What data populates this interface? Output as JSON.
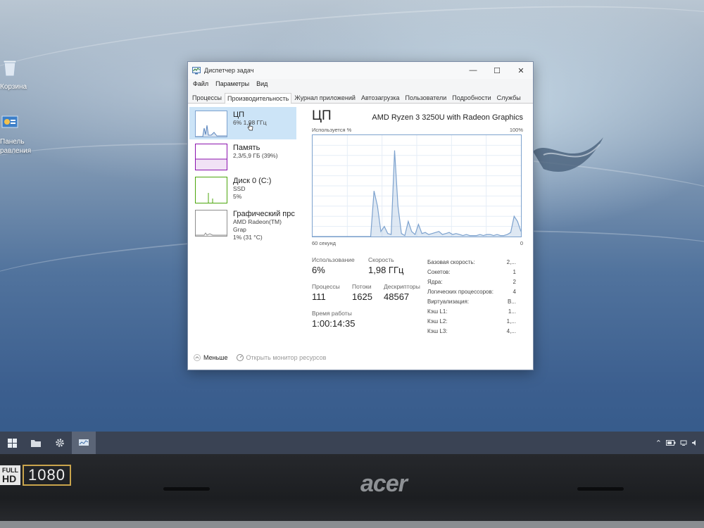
{
  "desktop": {
    "icons": [
      {
        "label": "Корзина"
      },
      {
        "label_line1": "Панель",
        "label_line2": "равления"
      }
    ]
  },
  "window": {
    "title": "Диспетчер задач",
    "menu": [
      "Файл",
      "Параметры",
      "Вид"
    ],
    "tabs": [
      "Процессы",
      "Производительность",
      "Журнал приложений",
      "Автозагрузка",
      "Пользователи",
      "Подробности",
      "Службы"
    ],
    "active_tab": 1
  },
  "sidebar": {
    "items": [
      {
        "name": "ЦП",
        "sub1": "6% 1,98 ГГц",
        "sub2": ""
      },
      {
        "name": "Память",
        "sub1": "2,3/5,9 ГБ (39%)",
        "sub2": ""
      },
      {
        "name": "Диск 0 (C:)",
        "sub1": "SSD",
        "sub2": "5%"
      },
      {
        "name": "Графический прс",
        "sub1": "AMD Radeon(TM) Grap",
        "sub2": "1% (31 °C)"
      }
    ]
  },
  "cpu": {
    "title": "ЦП",
    "model": "AMD Ryzen 3 3250U with Radeon Graphics",
    "graph_label": "Используется %",
    "graph_max": "100%",
    "graph_time": "60 секунд",
    "graph_min": "0",
    "graph_color": "#7da2ce",
    "usage_history": [
      0,
      0,
      0,
      0,
      0,
      0,
      0,
      0,
      0,
      0,
      0,
      0,
      0,
      0,
      0,
      0,
      0,
      0,
      45,
      30,
      5,
      10,
      3,
      2,
      85,
      30,
      3,
      1,
      15,
      5,
      2,
      12,
      3,
      4,
      2,
      3,
      4,
      5,
      2,
      3,
      4,
      2,
      3,
      2,
      1,
      2,
      1,
      1,
      1,
      2,
      1,
      2,
      2,
      1,
      2,
      1,
      1,
      2,
      4,
      20,
      15,
      5
    ],
    "stats": {
      "usage_label": "Использование",
      "usage_value": "6%",
      "speed_label": "Скорость",
      "speed_value": "1,98 ГГц",
      "processes_label": "Процессы",
      "processes_value": "111",
      "threads_label": "Потоки",
      "threads_value": "1625",
      "handles_label": "Дескрипторы",
      "handles_value": "48567",
      "uptime_label": "Время работы",
      "uptime_value": "1:00:14:35"
    },
    "props": [
      {
        "k": "Базовая скорость:",
        "v": "2,..."
      },
      {
        "k": "Сокетов:",
        "v": "1"
      },
      {
        "k": "Ядра:",
        "v": "2"
      },
      {
        "k": "Логических процессоров:",
        "v": "4"
      },
      {
        "k": "Виртуализация:",
        "v": "В..."
      },
      {
        "k": "Кэш L1:",
        "v": "1..."
      },
      {
        "k": "Кэш L2:",
        "v": "1,..."
      },
      {
        "k": "Кэш L3:",
        "v": "4,..."
      }
    ]
  },
  "footer": {
    "less": "Меньше",
    "monitor": "Открыть монитор ресурсов"
  },
  "bezel": {
    "full": "FULL",
    "hd": "HD",
    "res": "1080",
    "brand": "acer"
  }
}
